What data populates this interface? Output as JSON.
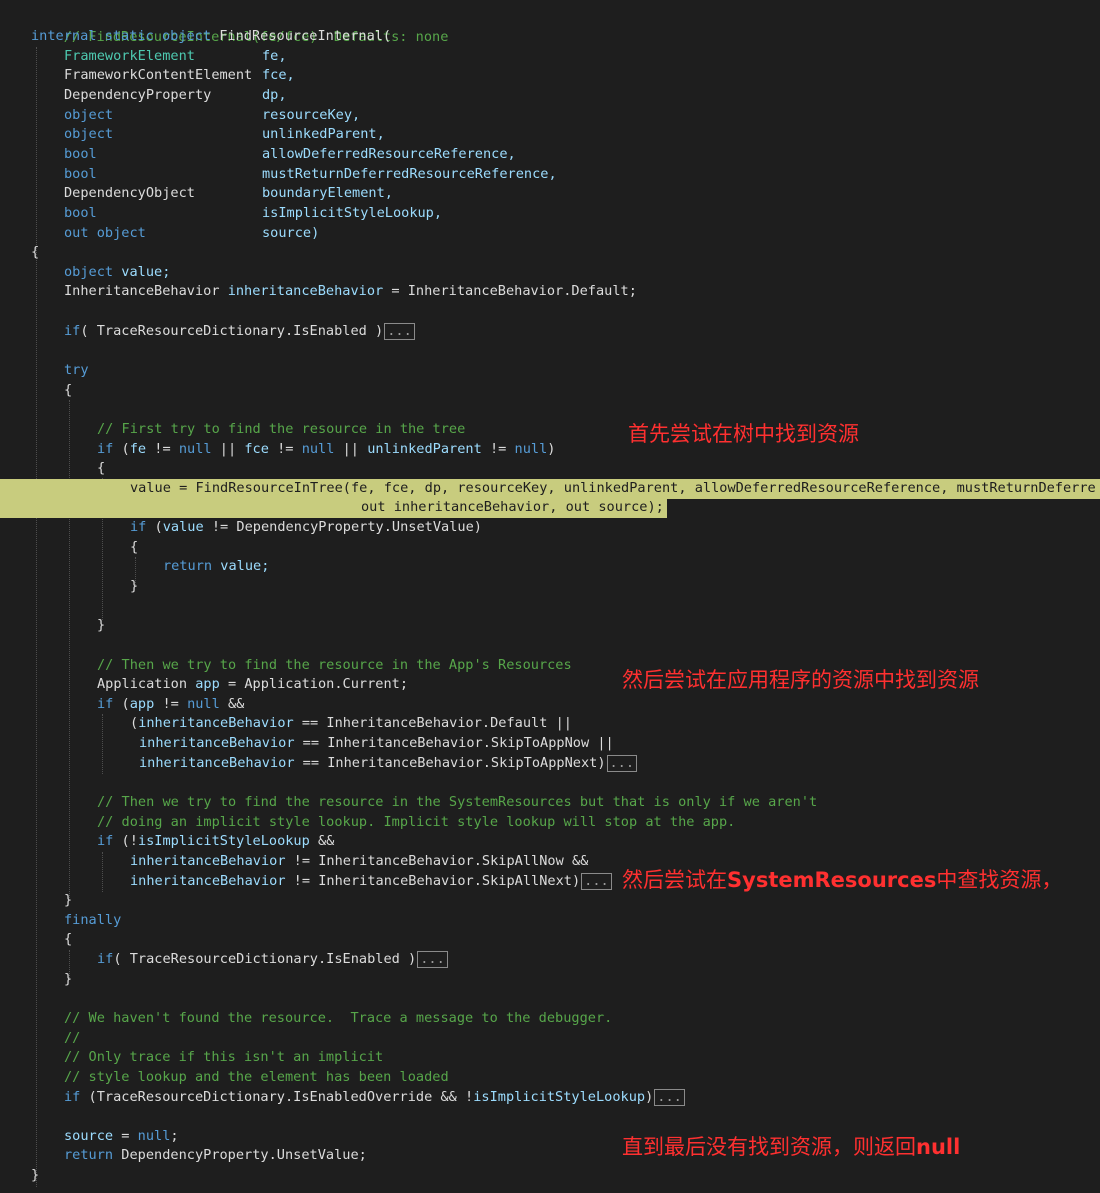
{
  "header_comment": "// FindResourceInternal(fe/fce)  Defaults: none",
  "signature": {
    "mods": "internal static object",
    "name": "FindResourceInternal("
  },
  "params": [
    {
      "type": "FrameworkElement",
      "name": "fe,"
    },
    {
      "type": "FrameworkContentElement",
      "name": "fce,"
    },
    {
      "type": "DependencyProperty",
      "name": "dp,"
    },
    {
      "type": "object",
      "name": "resourceKey,"
    },
    {
      "type": "object",
      "name": "unlinkedParent,"
    },
    {
      "type": "bool",
      "name": "allowDeferredResourceReference,"
    },
    {
      "type": "bool",
      "name": "mustReturnDeferredResourceReference,"
    },
    {
      "type": "DependencyObject",
      "name": "boundaryElement,"
    },
    {
      "type": "bool",
      "name": "isImplicitStyleLookup,"
    },
    {
      "type": "out object",
      "name": "source)"
    }
  ],
  "code": {
    "open_brace": "{",
    "close_brace": "}",
    "kw_object": "object",
    "value_decl": "value;",
    "inh_type": "InheritanceBehavior",
    "inh_var": "inheritanceBehavior",
    "inh_init": " = InheritanceBehavior.Default;",
    "if_kw": "if",
    "trace_if": "( TraceResourceDictionary.IsEnabled )",
    "fold": "...",
    "try_kw": "try",
    "finally_kw": "finally",
    "cmt_tree": "// First try to find the resource in the tree",
    "if_tree": {
      "p1": " (",
      "fe": "fe",
      "p2": " != ",
      "null": "null",
      "p3": " || ",
      "fce": "fce",
      "p4": " != ",
      "p5": " || ",
      "up": "unlinkedParent",
      "p6": " != ",
      "p7": ")"
    },
    "hl_line1": "value = FindResourceInTree(fe, fce, dp, resourceKey, unlinkedParent, allowDeferredResourceReference, mustReturnDeferre",
    "hl_line2": "out inheritanceBehavior, out source);",
    "if_unset_a": " (",
    "value_kw": "value",
    "if_unset_b": " != DependencyProperty.UnsetValue)",
    "return_kw": "return",
    "return_value": " value;",
    "cmt_app": "// Then we try to find the resource in the App's Resources",
    "app_decl": {
      "type": "Application",
      "var": "app",
      "rest": " = Application.Current;"
    },
    "if_app": {
      "p1": " (",
      "app": "app",
      "p2": " != ",
      "null": "null",
      "p3": " &&"
    },
    "cond1": {
      "open": "(",
      "var": "inheritanceBehavior",
      "rest": " == InheritanceBehavior.Default ||"
    },
    "cond2": {
      "var": "inheritanceBehavior",
      "rest": " == InheritanceBehavior.SkipToAppNow ||"
    },
    "cond3": {
      "var": "inheritanceBehavior",
      "rest": " == InheritanceBehavior.SkipToAppNext)"
    },
    "cmt_sys1": "// Then we try to find the resource in the SystemResources but that is only if we aren't",
    "cmt_sys2": "// doing an implicit style lookup. Implicit style lookup will stop at the app.",
    "if_sys": {
      "p1": " (!",
      "var": "isImplicitStyleLookup",
      "p2": " &&"
    },
    "sys_cond1": {
      "var": "inheritanceBehavior",
      "rest": " != InheritanceBehavior.SkipAllNow &&"
    },
    "sys_cond2": {
      "var": "inheritanceBehavior",
      "rest": " != InheritanceBehavior.SkipAllNext)"
    },
    "cmt_end1": "// We haven't found the resource.  Trace a message to the debugger.",
    "cmt_end2": "//",
    "cmt_end3": "// Only trace if this isn't an implicit",
    "cmt_end4": "// style lookup and the element has been loaded",
    "if_override": {
      "p1": " (TraceResourceDictionary.IsEnabledOverride && !",
      "var": "isImplicitStyleLookup",
      "p2": ")"
    },
    "source_var": "source",
    "source_eq": " = ",
    "null_kw": "null",
    "semi": ";",
    "return_unset": " DependencyProperty.UnsetValue;"
  },
  "annotations": {
    "tree": "首先尝试在树中找到资源",
    "app": "然后尝试在应用程序的资源中找到资源",
    "sys_before": "然后尝试在",
    "sys_bold": "SystemResources",
    "sys_after": "中查找资源，",
    "null_before": "直到最后没有找到资源，则返回",
    "null_bold": "null"
  },
  "colors": {
    "background": "#1e1e1e",
    "keyword": "#569cd6",
    "type": "#4ec9b0",
    "comment": "#57a64a",
    "identifier": "#9cdcfe",
    "highlight": "#c8cc7e",
    "annotation": "#ff3030"
  }
}
